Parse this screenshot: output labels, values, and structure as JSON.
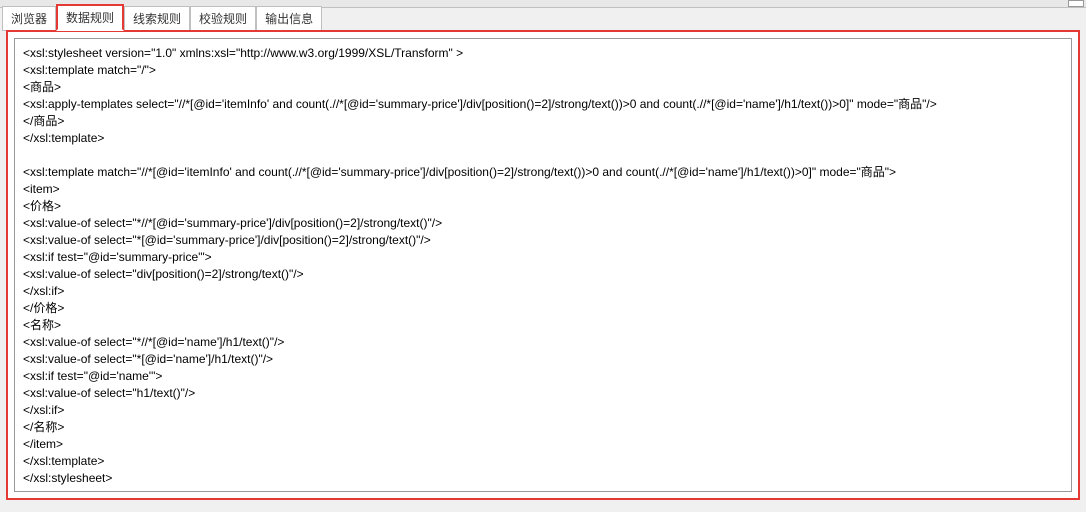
{
  "tabs": [
    {
      "label": "浏览器",
      "active": false
    },
    {
      "label": "数据规则",
      "active": true
    },
    {
      "label": "线索规则",
      "active": false
    },
    {
      "label": "校验规则",
      "active": false
    },
    {
      "label": "输出信息",
      "active": false
    }
  ],
  "code_lines": [
    "<xsl:stylesheet version=\"1.0\" xmlns:xsl=\"http://www.w3.org/1999/XSL/Transform\" >",
    "<xsl:template match=\"/\">",
    "<商品>",
    "<xsl:apply-templates select=\"//*[@id='itemInfo' and count(.//*[@id='summary-price']/div[position()=2]/strong/text())>0 and count(.//*[@id='name']/h1/text())>0]\" mode=\"商品\"/>",
    "</商品>",
    "</xsl:template>",
    "",
    "<xsl:template match=\"//*[@id='itemInfo' and count(.//*[@id='summary-price']/div[position()=2]/strong/text())>0 and count(.//*[@id='name']/h1/text())>0]\" mode=\"商品\">",
    "<item>",
    "<价格>",
    "<xsl:value-of select=\"*//*[@id='summary-price']/div[position()=2]/strong/text()\"/>",
    "<xsl:value-of select=\"*[@id='summary-price']/div[position()=2]/strong/text()\"/>",
    "<xsl:if test=\"@id='summary-price'\">",
    "<xsl:value-of select=\"div[position()=2]/strong/text()\"/>",
    "</xsl:if>",
    "</价格>",
    "<名称>",
    "<xsl:value-of select=\"*//*[@id='name']/h1/text()\"/>",
    "<xsl:value-of select=\"*[@id='name']/h1/text()\"/>",
    "<xsl:if test=\"@id='name'\">",
    "<xsl:value-of select=\"h1/text()\"/>",
    "</xsl:if>",
    "</名称>",
    "</item>",
    "</xsl:template>",
    "</xsl:stylesheet>"
  ]
}
